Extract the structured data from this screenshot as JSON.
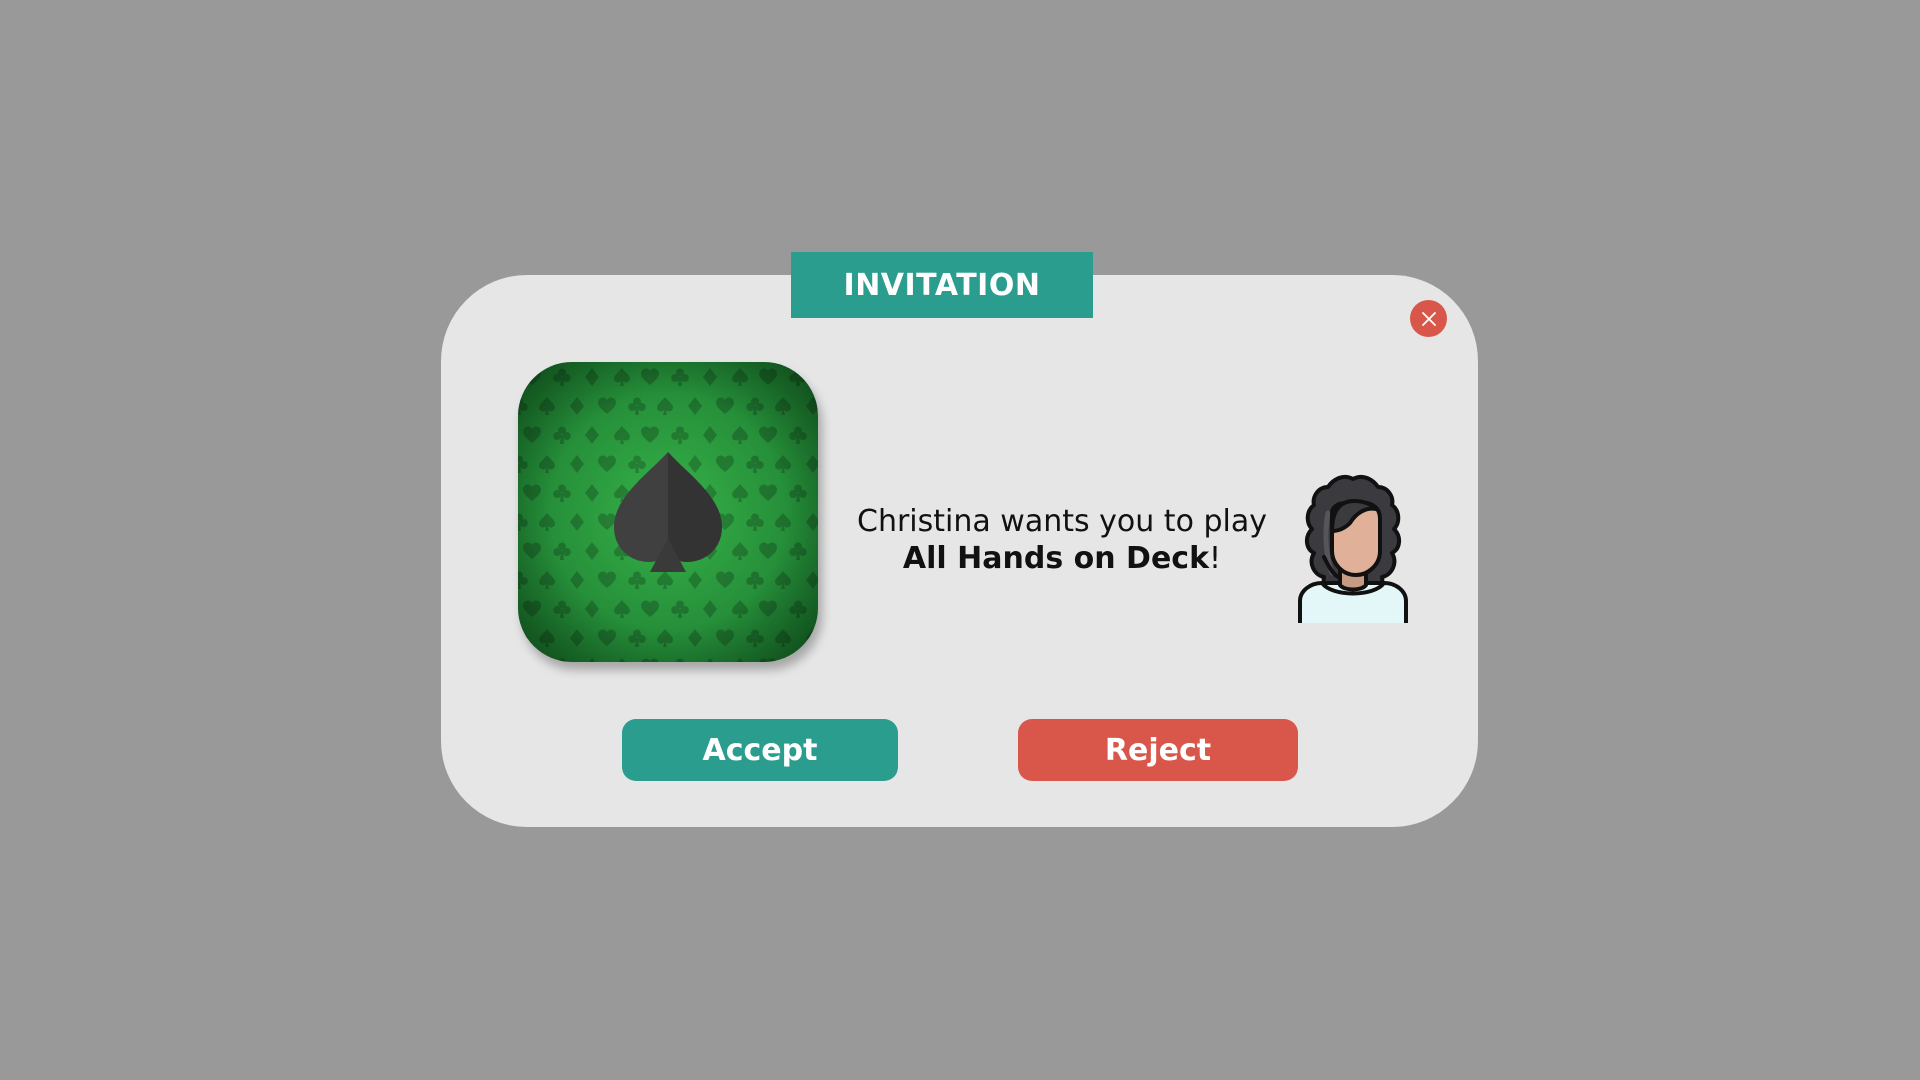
{
  "dialog": {
    "title": "INVITATION",
    "close_icon": "close-x-icon",
    "game_icon": "spade-icon",
    "message_line1": "Christina wants you to play",
    "game_name": "All Hands on Deck",
    "punctuation": "!",
    "avatar_icon": "woman-avatar-icon",
    "accept_label": "Accept",
    "reject_label": "Reject"
  },
  "colors": {
    "backdrop": "#999999",
    "dialog_bg": "#e6e6e6",
    "accent_teal": "#2a9d8f",
    "danger_red": "#d9574a",
    "felt_green": "#2e9e3e"
  }
}
